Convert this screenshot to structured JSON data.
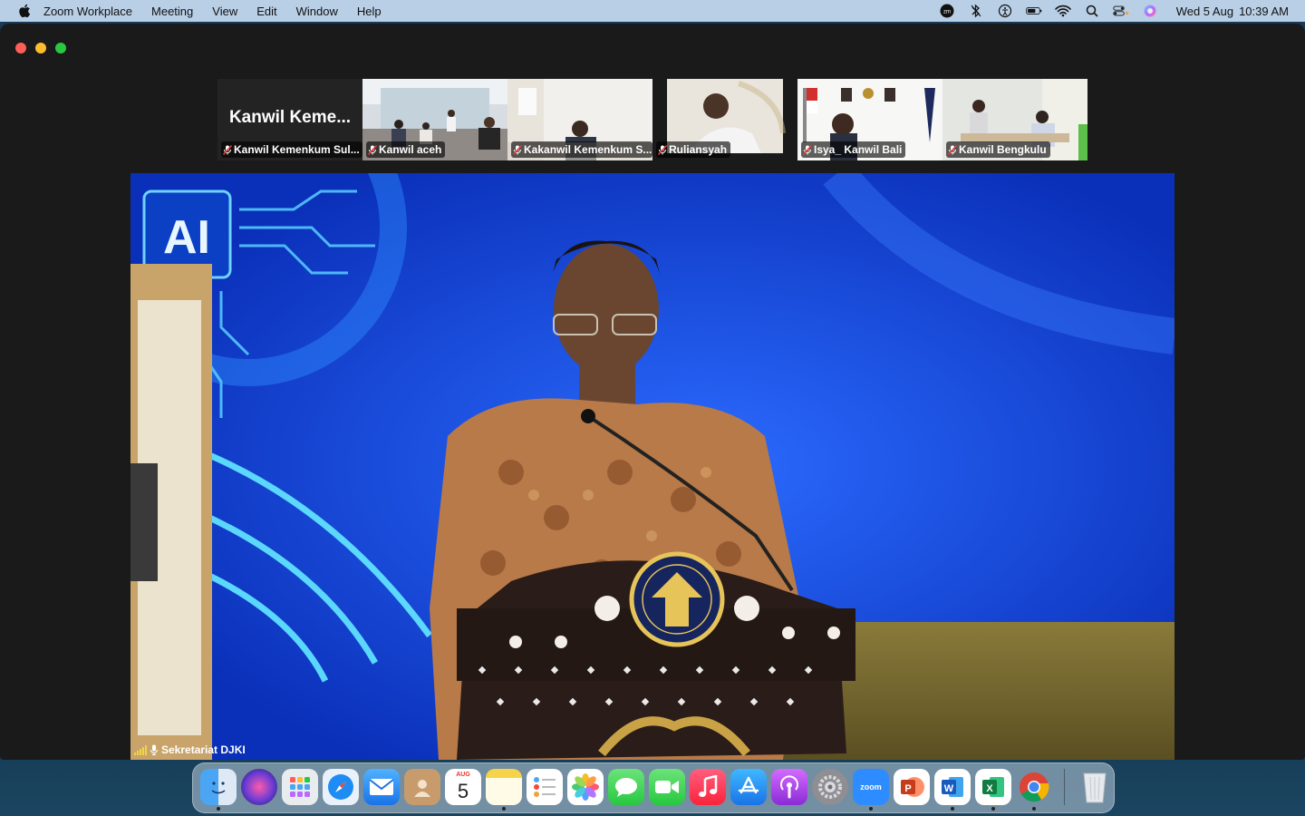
{
  "menubar": {
    "app_name": "Zoom Workplace",
    "menus": [
      "Meeting",
      "View",
      "Edit",
      "Window",
      "Help"
    ],
    "clock_date": "Wed 5 Aug",
    "clock_time": "10:39 AM",
    "status_icons": [
      "zoom-menu-icon",
      "bluetooth-icon",
      "accessibility-icon",
      "battery-icon",
      "wifi-icon",
      "spotlight-search-icon",
      "control-center-icon",
      "siri-icon"
    ]
  },
  "gallery": {
    "first_tile_name": "Kanwil Keme...",
    "participants": [
      {
        "label": "Kanwil Kemenkum Sul..."
      },
      {
        "label": "Kanwil aceh"
      },
      {
        "label": "Kakanwil Kemenkum S..."
      },
      {
        "label": "Ruliansyah"
      },
      {
        "label": "Isya_ Kanwil Bali"
      },
      {
        "label": "Kanwil Bengkulu"
      }
    ]
  },
  "main_video": {
    "speaker_name": "Sekretariat DJKI",
    "banner_text": "AI"
  },
  "dock": {
    "apps": [
      "finder",
      "siri",
      "launchpad",
      "safari",
      "mail",
      "contacts",
      "calendar",
      "notes",
      "reminders",
      "photos",
      "messages",
      "facetime",
      "music",
      "app-store",
      "podcasts",
      "system-settings",
      "zoom",
      "powerpoint",
      "word",
      "excel",
      "chrome"
    ],
    "calendar_month": "AUG",
    "calendar_day": "5",
    "zoom_label": "zoom",
    "trash": "trash"
  },
  "colors": {
    "menubar": "#b9cfe6",
    "window": "#1a1a1a",
    "stage_blue": "#1f5bff",
    "close": "#ff5f57",
    "minimize": "#febc2e",
    "maximize": "#28c840"
  }
}
